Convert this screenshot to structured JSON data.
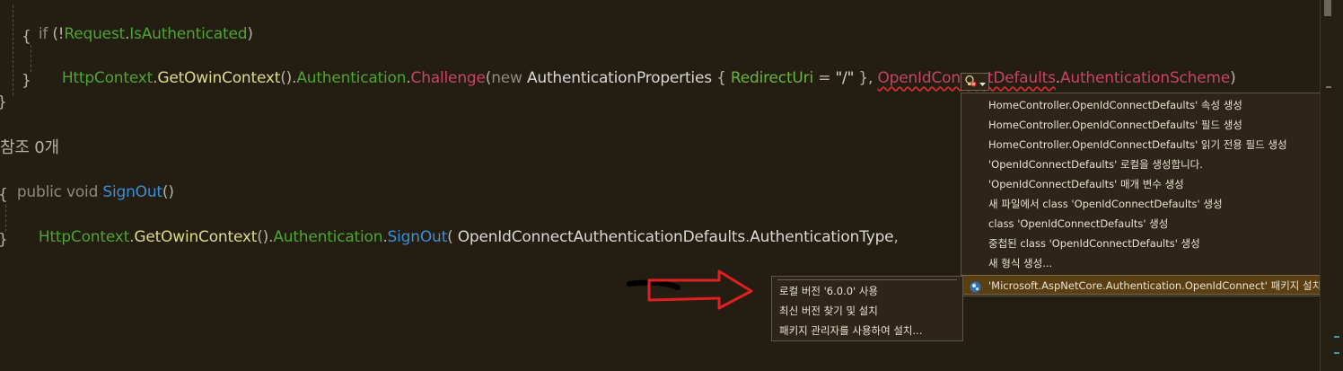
{
  "code": {
    "line1": [
      "if",
      " (!",
      "Request",
      ".",
      "IsAuthenticated",
      ")"
    ],
    "line2": "{",
    "line3": [
      "HttpContext",
      ".",
      "GetOwinContext",
      "().",
      "Authentication",
      ".",
      "Challenge",
      "(",
      "new",
      " ",
      "AuthenticationProperties",
      " { ",
      "RedirectUri",
      " = ",
      "\"/\"",
      " }, ",
      "OpenIdConnectDefaults",
      ".",
      "AuthenticationScheme",
      ")"
    ],
    "line4": "}",
    "line5": "}",
    "refs": "참조 0개",
    "line7": [
      "public void ",
      "SignOut",
      "()"
    ],
    "line8": "{",
    "line9": [
      "HttpContext",
      ".",
      "GetOwinContext",
      "().",
      "Authentication",
      ".",
      "SignOut",
      "( ",
      "OpenIdConnectAuthenticationDefaults",
      ".",
      "AuthenticationType",
      ", "
    ],
    "line10": "}"
  },
  "quick_actions": {
    "items": [
      "HomeController.OpenIdConnectDefaults' 속성 생성",
      "HomeController.OpenIdConnectDefaults' 필드 생성",
      "HomeController.OpenIdConnectDefaults' 읽기 전용 필드 생성",
      "'OpenIdConnectDefaults' 로컬을 생성합니다.",
      "'OpenIdConnectDefaults' 매개 변수 생성",
      "새 파일에서 class 'OpenIdConnectDefaults' 생성",
      "class 'OpenIdConnectDefaults' 생성",
      "중첩된 class 'OpenIdConnectDefaults' 생성",
      "새 형식 생성..."
    ],
    "selected_item": "'Microsoft.AspNetCore.Authentication.OpenIdConnect' 패키지 설치"
  },
  "submenu": {
    "items": [
      "로컬 버전 '6.0.0' 사용",
      "최신 버전 찾기 및 설치",
      "패키지 관리자를 사용하여 설치..."
    ]
  },
  "colors": {
    "background": "#231d12",
    "menu_bg": "#2d2618",
    "selected_bg": "#5a3f13",
    "annotation_arrow": "#e02020"
  },
  "icons": {
    "lightbulb": "lightbulb-error-icon",
    "nuget": "nuget-package-icon",
    "submenu_arrow": "chevron-right-icon",
    "dropdown": "chevron-down-icon"
  }
}
